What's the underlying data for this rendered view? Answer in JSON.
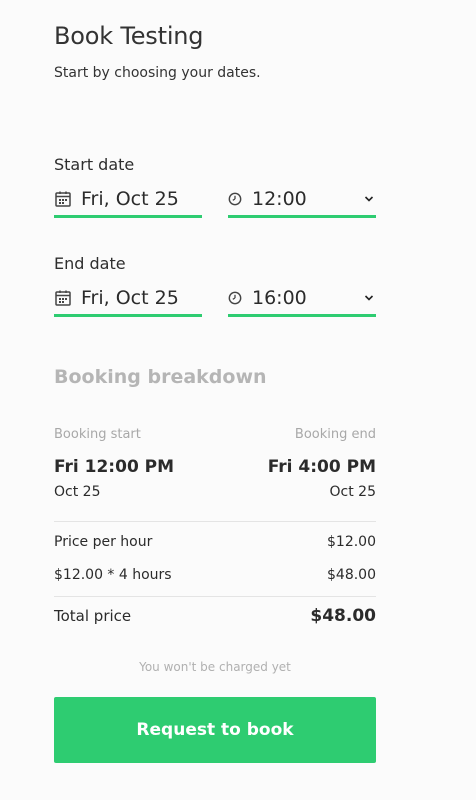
{
  "header": {
    "title": "Book Testing",
    "subtitle": "Start by choosing your dates."
  },
  "start": {
    "label": "Start date",
    "date": "Fri, Oct 25",
    "time": "12:00"
  },
  "end": {
    "label": "End date",
    "date": "Fri, Oct 25",
    "time": "16:00"
  },
  "breakdown": {
    "heading": "Booking breakdown",
    "start_label": "Booking start",
    "end_label": "Booking end",
    "start_time": "Fri 12:00 PM",
    "end_time": "Fri 4:00 PM",
    "start_date": "Oct 25",
    "end_date": "Oct 25",
    "price_per_hour_label": "Price per hour",
    "price_per_hour_value": "$12.00",
    "calc_label": "$12.00 * 4 hours",
    "calc_value": "$48.00",
    "total_label": "Total price",
    "total_value": "$48.00"
  },
  "note": "You won't be charged yet",
  "cta": {
    "label": "Request to book"
  },
  "colors": {
    "accent": "#2ecc71",
    "muted": "#a8a8a8",
    "background": "#fbfbfb"
  },
  "icons": {
    "date": "calendar-icon",
    "time": "clock-icon",
    "dropdown": "chevron-down-icon"
  }
}
